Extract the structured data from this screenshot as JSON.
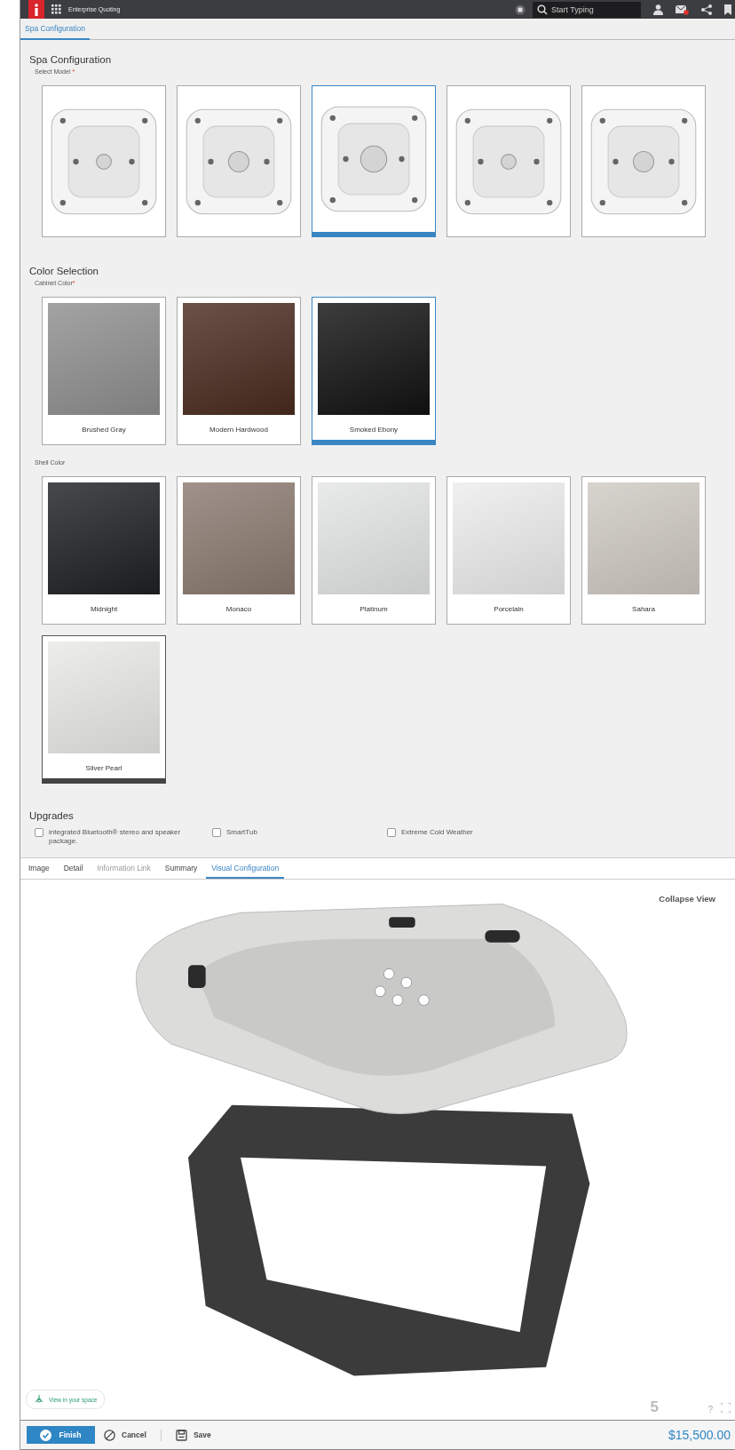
{
  "header": {
    "app_title": "Enterprise Quoting",
    "search": {
      "placeholder": "Start Typing"
    }
  },
  "page_tabs": [
    {
      "label": "Spa Configuration",
      "selected": true
    }
  ],
  "spa_configuration": {
    "title": "Spa Configuration",
    "select_model": {
      "label": "Select Model",
      "required_mark": "*",
      "models": [
        {
          "selected": false
        },
        {
          "selected": false
        },
        {
          "selected": true
        },
        {
          "selected": false
        },
        {
          "selected": false
        }
      ]
    }
  },
  "color_selection": {
    "title": "Color Selection",
    "groups": [
      {
        "kind": "cabinet",
        "label": "Cabinet Color",
        "required_mark": "*",
        "swatches": [
          {
            "name": "Brushed Gray",
            "color": "#8f8f8f",
            "selected": false
          },
          {
            "name": "Modern Hardwood",
            "color": "#4a2b1f",
            "selected": false
          },
          {
            "name": "Smoked Ebony",
            "color": "#121212",
            "selected": true
          }
        ]
      },
      {
        "kind": "shell",
        "label": "Shell Color",
        "swatches": [
          {
            "name": "Midnight",
            "color": "#1e2124",
            "selected": false
          },
          {
            "name": "Monaco",
            "color": "#8b7a70",
            "selected": false
          },
          {
            "name": "Platinum",
            "color": "#e4e6e6",
            "selected": false
          },
          {
            "name": "Porcelain",
            "color": "#ededee",
            "selected": false
          },
          {
            "name": "Sahara",
            "color": "#cfcac3",
            "selected": false
          },
          {
            "name": "Silver Pearl",
            "color": "#e9e9e7",
            "selected": true
          }
        ]
      }
    ]
  },
  "upgrades": {
    "title": "Upgrades",
    "options": [
      {
        "label": "integrated Bluetooth® stereo and speaker package.",
        "checked": false
      },
      {
        "label": "SmartTub",
        "checked": false
      },
      {
        "label": "Extreme Cold Weather",
        "checked": false
      }
    ]
  },
  "detail_tabs": [
    {
      "label": "Image",
      "selected": false,
      "disabled": false
    },
    {
      "label": "Detail",
      "selected": false,
      "disabled": false
    },
    {
      "label": "Information Link",
      "selected": false,
      "disabled": true
    },
    {
      "label": "Summary",
      "selected": false,
      "disabled": false
    },
    {
      "label": "Visual Configuration",
      "selected": true,
      "disabled": false
    }
  ],
  "visual": {
    "collapse": "Collapse View",
    "ar_button": "View in your space",
    "badge": "5",
    "help": "?"
  },
  "footer": {
    "finish": "Finish",
    "cancel": "Cancel",
    "save": "Save",
    "total": "$15,500.00"
  }
}
